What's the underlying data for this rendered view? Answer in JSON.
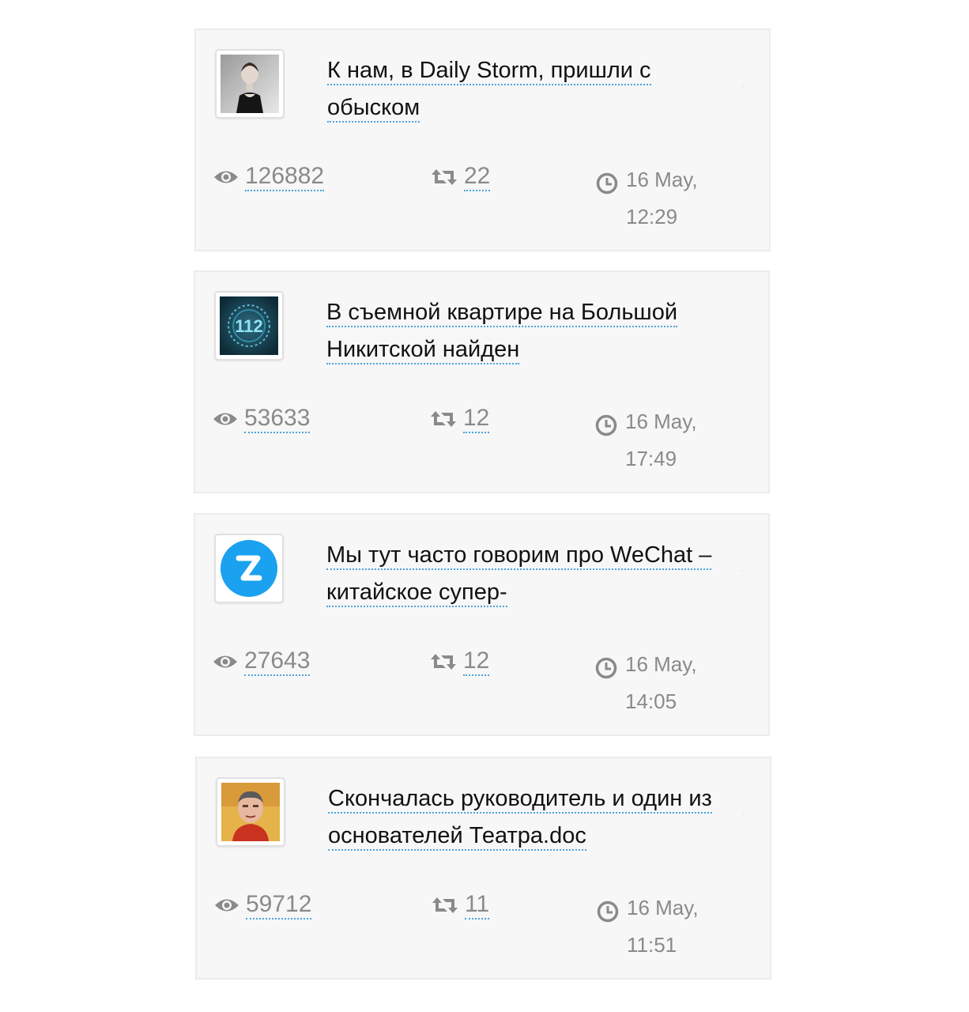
{
  "posts": [
    {
      "title": "К нам, в Daily Storm, пришли с обыском",
      "views": "126882",
      "reposts": "22",
      "date": "16 May, 12:29",
      "avatar_icon": "woman-portrait-avatar"
    },
    {
      "title": "В съемной квартире на Большой Никитской найден",
      "views": "53633",
      "reposts": "12",
      "date": "16 May, 17:49",
      "avatar_icon": "channel-112-logo"
    },
    {
      "title": "Мы тут часто говорим про WeChat – китайское супер-",
      "views": "27643",
      "reposts": "12",
      "date": "16 May, 14:05",
      "avatar_icon": "blue-z-logo"
    },
    {
      "title": "Скончалась руководитель и один из основателей Театра.doc",
      "views": "59712",
      "reposts": "11",
      "date": "16 May, 11:51",
      "avatar_icon": "painted-man-portrait-avatar"
    }
  ],
  "colors": {
    "card_bg": "#f7f7f7",
    "link_underline": "#4aa3df",
    "stat_text": "#8a8a8a"
  }
}
